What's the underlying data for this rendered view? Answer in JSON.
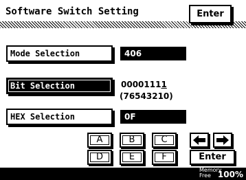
{
  "header": {
    "title": "Software Switch Setting",
    "enter_label": "Enter"
  },
  "rows": {
    "mode": {
      "label": "Mode Selection",
      "value": "406"
    },
    "bit": {
      "label": "Bit Selection",
      "value_prefix": "0000111",
      "value_cursor": "1",
      "index_hint": "(76543210)"
    },
    "hex": {
      "label": "HEX Selection",
      "value": "0F"
    }
  },
  "keypad": {
    "keys": [
      "A",
      "B",
      "C",
      "D",
      "E",
      "F"
    ],
    "left_arrow_icon": "left-arrow-icon",
    "right_arrow_icon": "right-arrow-icon",
    "enter_label": "Enter"
  },
  "status": {
    "memory_label": "Memory Free",
    "memory_line1": "Memory",
    "memory_line2": "Free",
    "memory_value": "100%"
  }
}
